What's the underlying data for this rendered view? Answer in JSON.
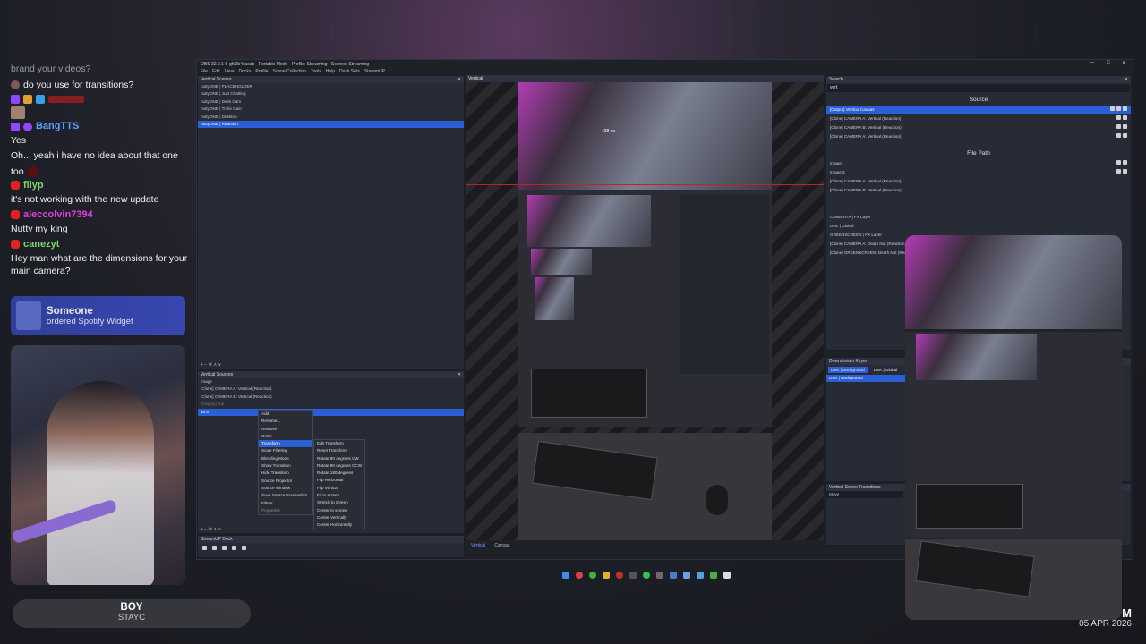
{
  "chat": {
    "lines": [
      {
        "text": "brand your videos?",
        "style": "faded"
      },
      {
        "text": "do you use for transitions?",
        "style": "msg"
      },
      {
        "user": "BangTTS",
        "color": "#56a4ff",
        "badge": "twitch"
      },
      {
        "text": "Yes",
        "style": "msg"
      },
      {
        "text": "Oh... yeah i have no idea about that one",
        "style": "msg"
      },
      {
        "text": "too",
        "style": "msg"
      },
      {
        "user": "filyp",
        "color": "#7ed56a",
        "badge": "youtube"
      },
      {
        "text": "it's not working with the new update",
        "style": "msg"
      },
      {
        "user": "aleccolvin7394",
        "color": "#e040e0",
        "badge": "youtube"
      },
      {
        "text": "Nutty my king",
        "style": "msg"
      },
      {
        "user": "canezyt",
        "color": "#7ed56a",
        "badge": "youtube"
      },
      {
        "text": "Hey man what are the dimensions for your main camera?",
        "style": "msg"
      }
    ]
  },
  "alert": {
    "name": "Someone",
    "text": "ordered Spotify Widget"
  },
  "now_playing": {
    "title": "BOY",
    "artist": "STAYC"
  },
  "obs": {
    "title": "OBS 32.0.1-5-gfc2b4cacab - Portable Mode - Profile: Streaming - Scenes: Streaming",
    "menu": [
      "File",
      "Edit",
      "View",
      "Docks",
      "Profile",
      "Scene Collection",
      "Tools",
      "Help",
      "Dock Sets",
      "StreamUP"
    ],
    "scenes_header": "Vertical Scenes",
    "scenes": [
      "nuttyONE | PLACEHOLDER",
      "nuttyONE | Just Chatting",
      "nuttyONE | Desk Cam",
      "nuttyONE | Triple Cam",
      "nuttyONE | Desktop",
      "nuttyONE | Reaction"
    ],
    "selected_scene": 5,
    "preview_header": "Vertical",
    "sources_header": "Vertical Sources",
    "sources": [
      "Image",
      "[Clone] CAMERA A: Vertical (Reaction)",
      "[Clone] CAMERA B: Vertical (Reaction)",
      "[Display] Top",
      "16:9"
    ],
    "context_menu": [
      "Add",
      "Rename...",
      "Remove",
      "Order",
      "Transform",
      "Scale Filtering",
      "Blending Mode",
      "Show Transition",
      "Hide Transition",
      "Source Projector",
      "Source Window",
      "Save Source Screenshot",
      "Filters",
      "Properties"
    ],
    "context_selected": "Transform",
    "submenu": [
      "Edit Transform",
      "Reset Transform",
      "Rotate 90 degrees CW",
      "Rotate 90 degrees CCW",
      "Rotate 180 degrees",
      "Flip Horizontal",
      "Flip Vertical",
      "Fit to screen",
      "Stretch to screen",
      "Center to screen",
      "Center Vertically",
      "Center Horizontally"
    ],
    "dock_header": "StreamUP Dock",
    "search_header": "Search",
    "search_value": "vert",
    "source_group": "Source",
    "source_results": [
      "[Output] Vertical Canvas",
      "[Clone] CAMERA A: Vertical (Reaction)",
      "[Clone] CAMERA B: Vertical (Reaction)",
      "[Clone] CAMERA A: Vertical (Reaction)"
    ],
    "filepath_group": "File Path",
    "filepath_results": [
      "Image",
      "Image 3",
      "[Clone] CAMERA A: Vertical (Reaction)",
      "[Clone] CAMERA B: Vertical (Reaction)"
    ],
    "filter_results": [
      "CAMERA A | FX Layer",
      "DSK | Global",
      "GREENSCREEN | FX Layer",
      "[Clone] CAMERA A: Death Nut (Reaction)",
      "[Clone] GREENSCREEN: Death Nut (Reaction)"
    ],
    "dsk_header": "Downstream Keyer",
    "dsk_tabs": [
      "DSK | Background",
      "DSK | Global"
    ],
    "dsk_item": "DSK | Background",
    "transitions_header": "Vertical Scene Transitions",
    "transition": "Move",
    "canvas_tabs": [
      "Vertical",
      "Canvas"
    ],
    "size_label": "438 px"
  },
  "clock": {
    "date": "05 APR 2026",
    "time": "M"
  },
  "colors": {
    "accent": "#2b5fd6",
    "stripe_red": "#c02030"
  }
}
